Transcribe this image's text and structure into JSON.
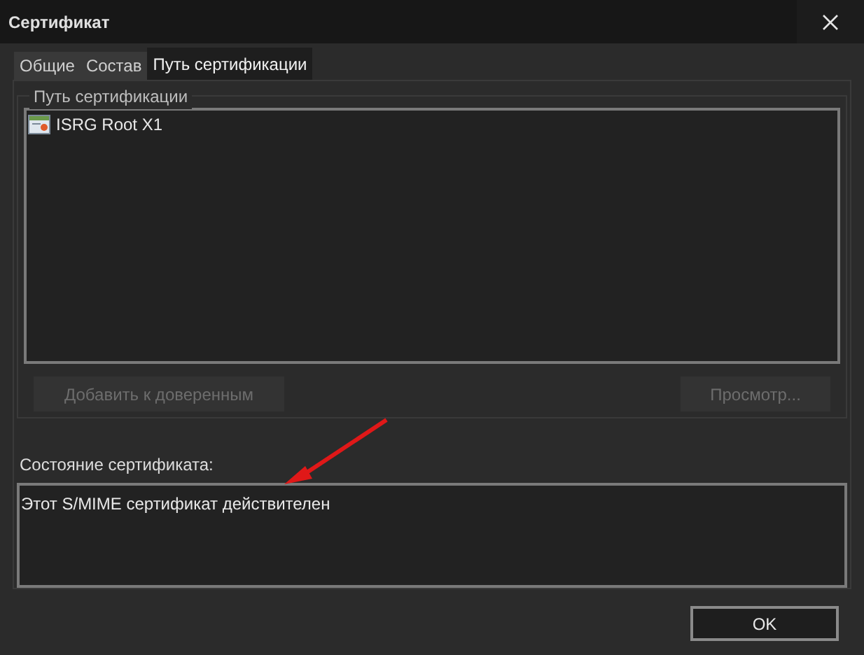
{
  "window": {
    "title": "Сертификат"
  },
  "tabs": [
    {
      "label": "Общие",
      "selected": false
    },
    {
      "label": "Состав",
      "selected": false
    },
    {
      "label": "Путь сертификации",
      "selected": true
    }
  ],
  "path_group": {
    "title": "Путь сертификации",
    "items": [
      {
        "label": "ISRG Root X1"
      }
    ],
    "buttons": [
      {
        "label": "Добавить к доверенным",
        "disabled": true
      },
      {
        "label": "Просмотр...",
        "disabled": true
      }
    ]
  },
  "status": {
    "label": "Состояние сертификата:",
    "value": "Этот S/MIME сертификат действителен"
  },
  "buttons": [
    {
      "label": "OK",
      "disabled": false
    }
  ]
}
